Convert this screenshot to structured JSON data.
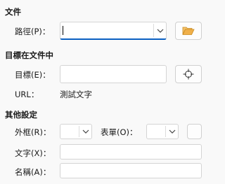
{
  "sections": {
    "document": {
      "title": "文件",
      "path_label": "路徑(P)：",
      "path_value": ""
    },
    "target": {
      "title": "目標在文件中",
      "target_label": "目標(E)：",
      "target_value": "",
      "url_label": "URL：",
      "url_value": "測試文字"
    },
    "other": {
      "title": "其他設定",
      "frame_label": "外框(R)：",
      "form_label": "表單(O)：",
      "text_label": "文字(X)：",
      "text_value": "",
      "name_label": "名稱(A)：",
      "name_value": ""
    }
  },
  "icons": {
    "open_folder": "folder-open-icon",
    "target_picker": "crosshair-icon",
    "dropdown": "chevron-down-icon"
  },
  "colors": {
    "focus_accent": "#0a60c2",
    "folder_icon": "#e8a33c"
  }
}
